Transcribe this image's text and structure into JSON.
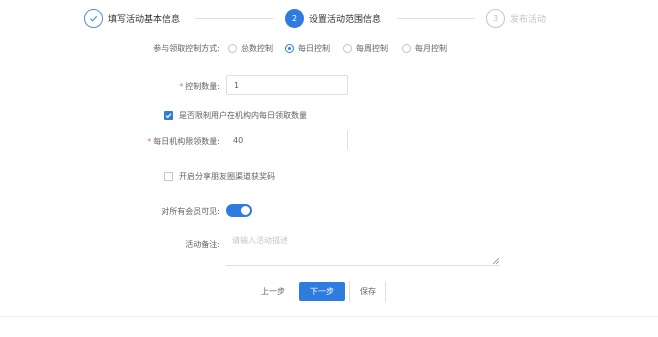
{
  "steps": [
    {
      "index": "",
      "title": "填写活动基本信息",
      "status": "done"
    },
    {
      "index": "2",
      "title": "设置活动范围信息",
      "status": "active"
    },
    {
      "index": "3",
      "title": "发布活动",
      "status": "wait"
    }
  ],
  "form": {
    "record_method": {
      "label": "参与领取控制方式:",
      "options": [
        "总数控制",
        "每日控制",
        "每周控制",
        "每月控制"
      ],
      "selected": "每日控制"
    },
    "control_count": {
      "label": "控制数量:",
      "value": "1"
    },
    "limit_checkbox": {
      "label": "是否限制用户在机构内每日领取数量",
      "checked": true
    },
    "daily_limit": {
      "label": "每日机构限领数量:",
      "value": "40"
    },
    "share_checkbox": {
      "label": "开启分享朋友圈渠道获奖码",
      "checked": false
    },
    "visible_switch": {
      "label": "对所有会员可见:",
      "on": true
    },
    "remark": {
      "label": "活动备注:",
      "placeholder": "请输入活动描述"
    }
  },
  "buttons": {
    "prev": "上一步",
    "next": "下一步",
    "save": "保存"
  },
  "colors": {
    "primary": "#2f7ce0",
    "required": "#f56c6c",
    "border": "#dcdfe6"
  }
}
